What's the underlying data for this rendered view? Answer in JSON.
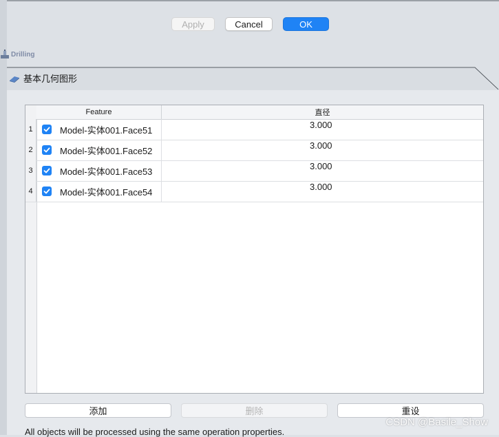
{
  "dialog_buttons": {
    "apply": "Apply",
    "cancel": "Cancel",
    "ok": "OK"
  },
  "section": {
    "label": "Drilling",
    "icon": "drill-icon"
  },
  "tab": {
    "label": "基本几何图形",
    "icon": "eraser-icon"
  },
  "table": {
    "columns": [
      "Feature",
      "直径"
    ],
    "rows": [
      {
        "index": "1",
        "checked": true,
        "feature": "Model-实体001.Face51",
        "diameter": "3.000"
      },
      {
        "index": "2",
        "checked": true,
        "feature": "Model-实体001.Face52",
        "diameter": "3.000"
      },
      {
        "index": "3",
        "checked": true,
        "feature": "Model-实体001.Face53",
        "diameter": "3.000"
      },
      {
        "index": "4",
        "checked": true,
        "feature": "Model-实体001.Face54",
        "diameter": "3.000"
      }
    ]
  },
  "actions": {
    "add": "添加",
    "delete": "删除",
    "reset": "重设"
  },
  "footer_note": "All objects will be processed using the same operation properties.",
  "watermark": "CSDN @Basile_Show",
  "colors": {
    "accent": "#1f83f5",
    "panel": "#e6e9ed",
    "background": "#dde1e6"
  }
}
